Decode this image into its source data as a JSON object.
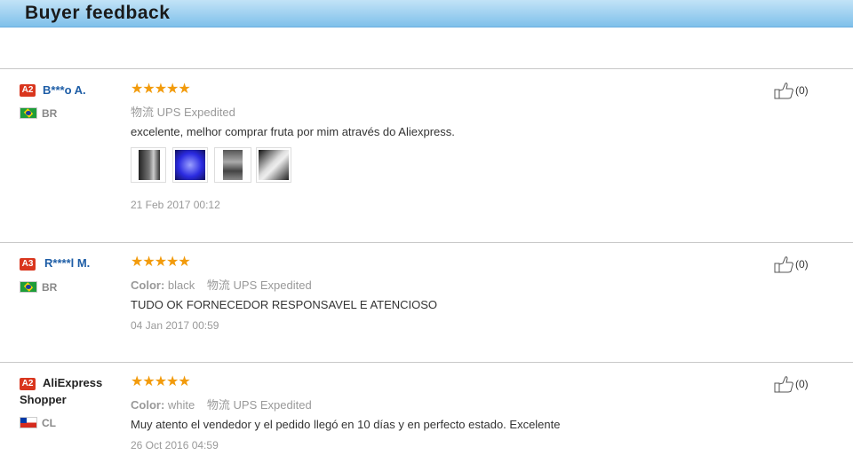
{
  "header": {
    "title": "Buyer feedback"
  },
  "reviews": [
    {
      "badge": "A2",
      "name": "B***o A.",
      "country": "BR",
      "stars": "★★★★★",
      "color_label": "",
      "color_value": "",
      "shipping_label": "物流",
      "shipping_value": "UPS Expedited",
      "text": "excelente, melhor comprar fruta por mim através do Aliexpress.",
      "photos": [
        "photo-1",
        "photo-2",
        "photo-3",
        "photo-4"
      ],
      "date": "21 Feb 2017 00:12",
      "likes": "(0)"
    },
    {
      "badge": "A3",
      "name": "R****l M.",
      "country": "BR",
      "stars": "★★★★★",
      "color_label": "Color:",
      "color_value": "black",
      "shipping_label": "物流",
      "shipping_value": "UPS Expedited",
      "text": "TUDO OK FORNECEDOR RESPONSAVEL E ATENCIOSO",
      "photos": [],
      "date": "04 Jan 2017 00:59",
      "likes": "(0)"
    },
    {
      "badge": "A2",
      "name": "AliExpress Shopper",
      "country": "CL",
      "stars": "★★★★★",
      "color_label": "Color:",
      "color_value": "white",
      "shipping_label": "物流",
      "shipping_value": "UPS Expedited",
      "text": "Muy atento el vendedor y el pedido llegó en 10 días y en perfecto estado. Excelente",
      "photos": [],
      "date": "26 Oct 2016 04:59",
      "likes": "(0)"
    }
  ],
  "colors": {
    "accent_blue": "#1d5da6",
    "star_orange": "#f29b0c",
    "badge_red": "#d9361e"
  },
  "icons": {
    "like": "thumbs-up-icon"
  }
}
